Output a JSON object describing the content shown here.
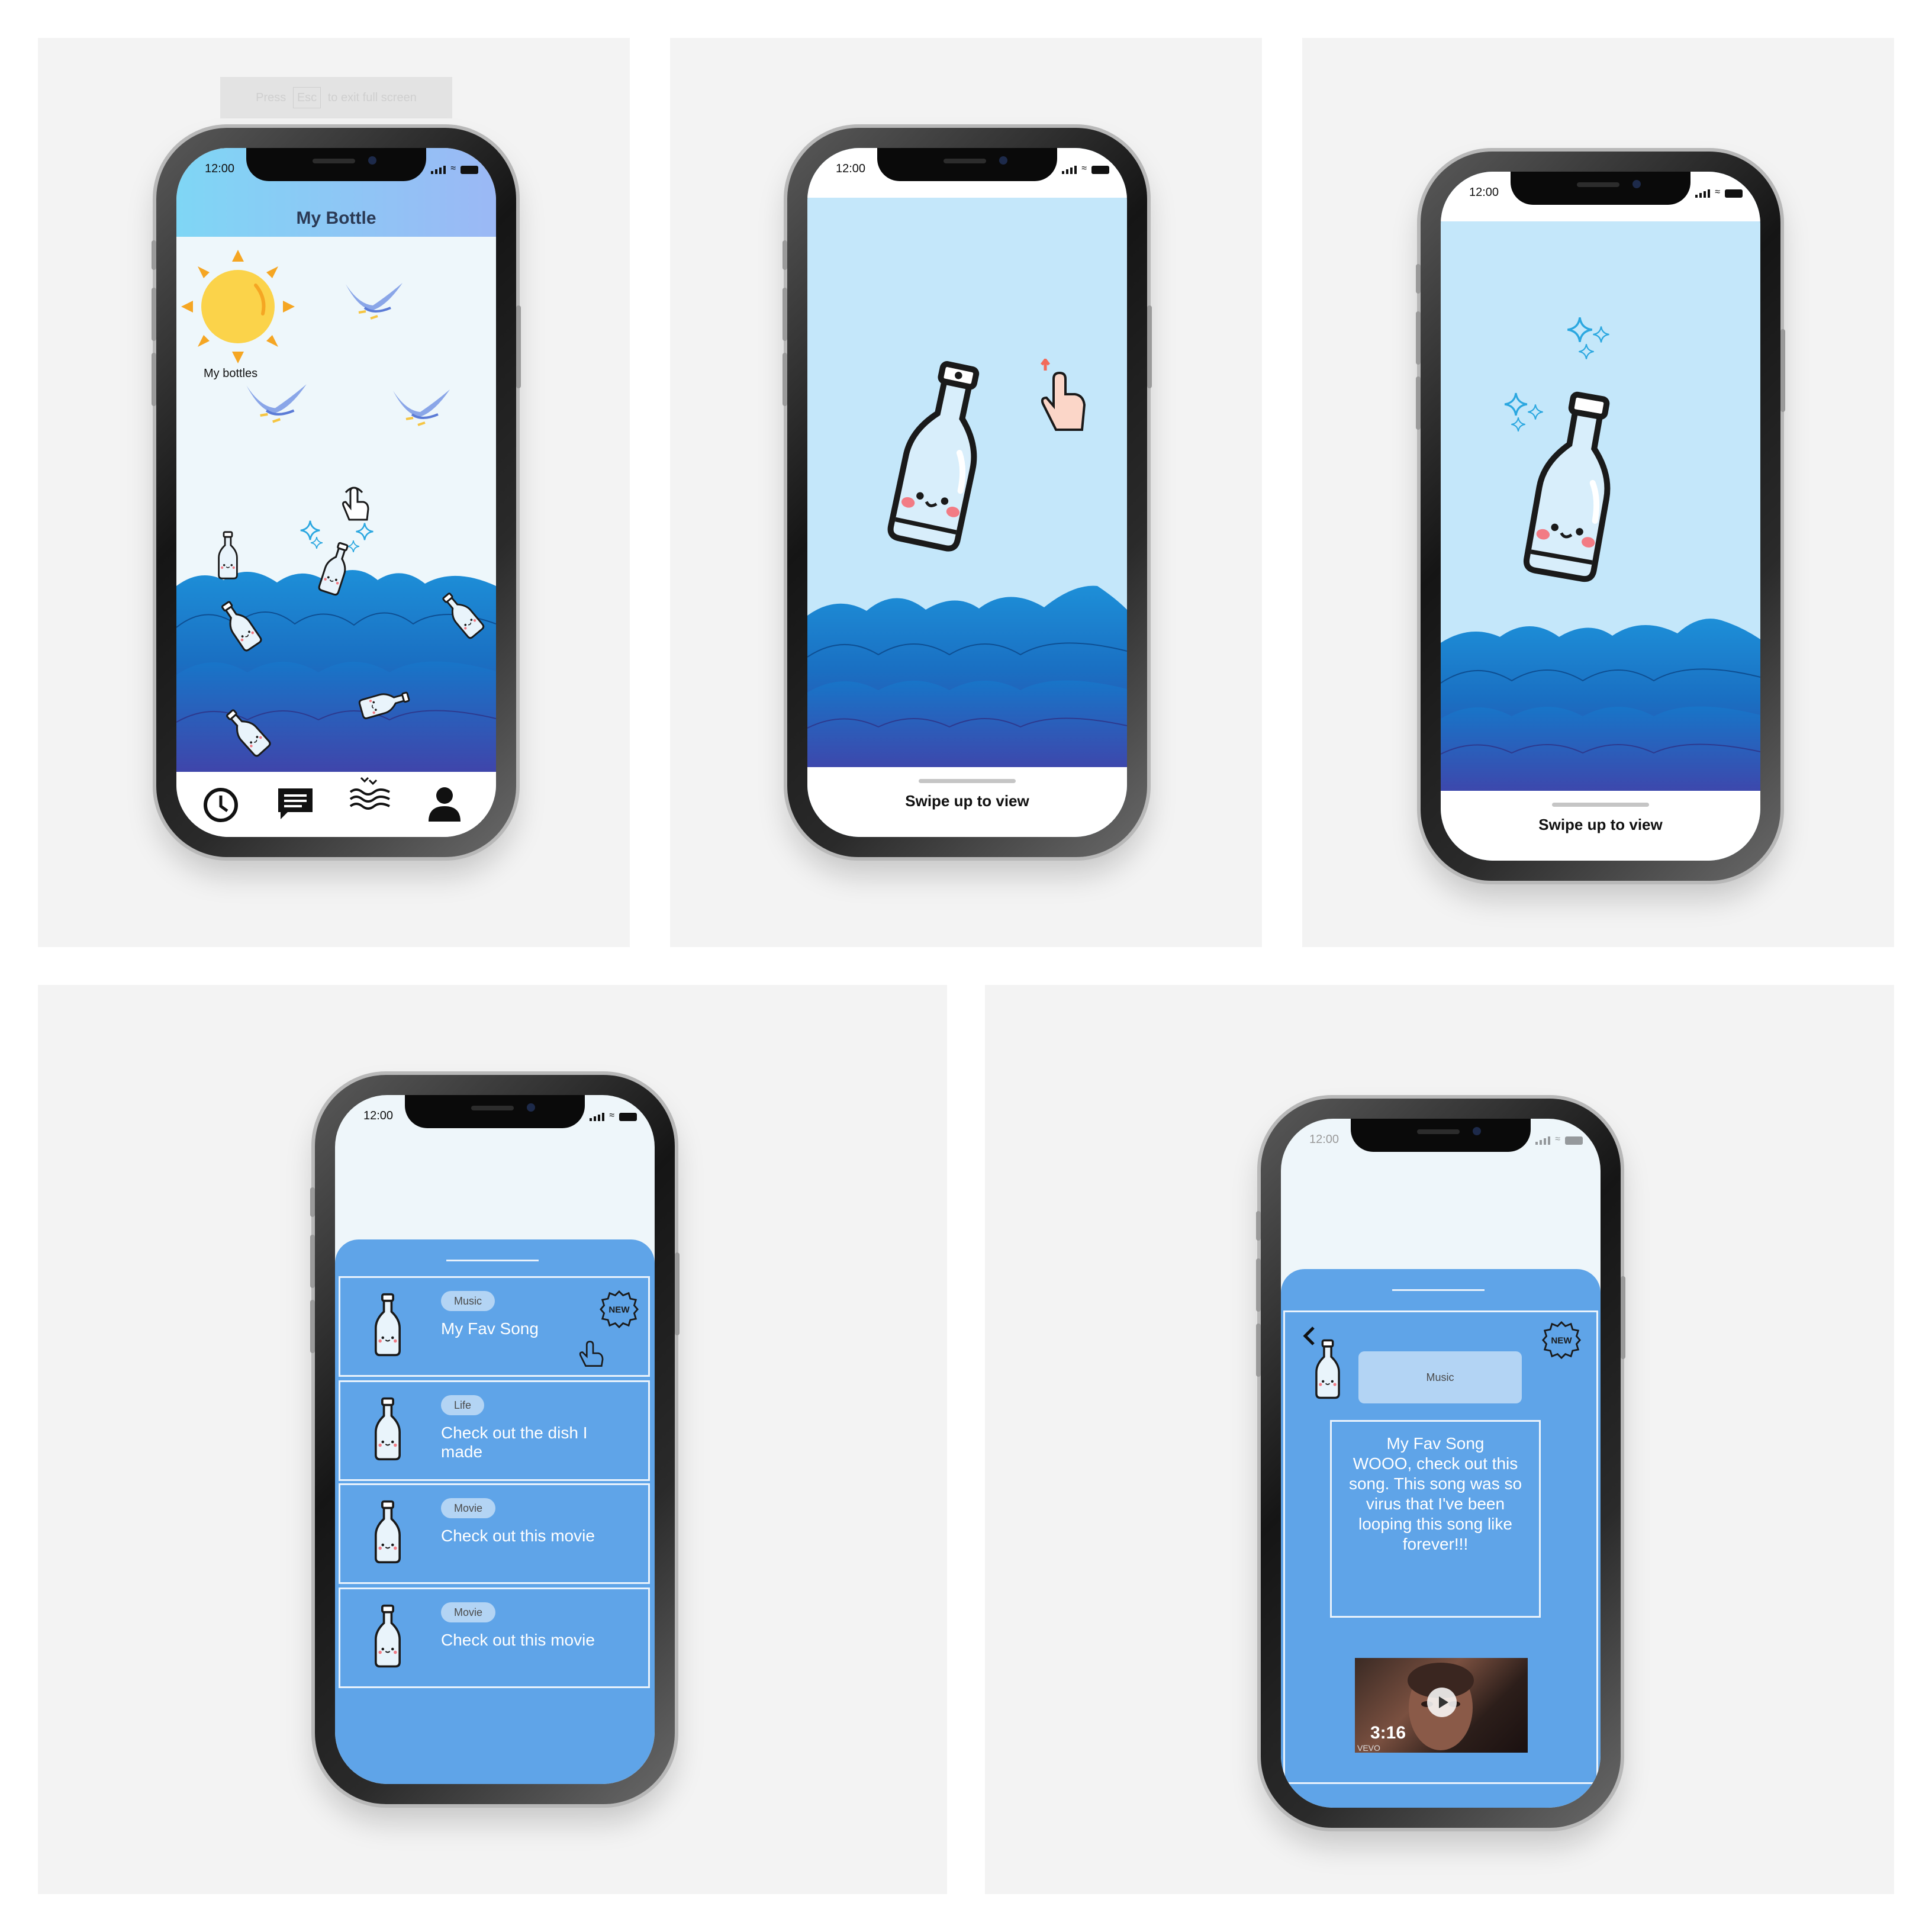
{
  "status_bar": {
    "time": "12:00"
  },
  "screen1": {
    "fullscreen_hint": {
      "prefix": "Press",
      "key": "Esc",
      "suffix": "to exit full screen"
    },
    "title": "My Bottle",
    "my_bottles_label": "My bottles",
    "tabs": [
      "history-icon",
      "chat-icon",
      "ocean-icon",
      "profile-icon"
    ]
  },
  "screen2": {
    "swipe_label": "Swipe up to view"
  },
  "screen3": {
    "swipe_label": "Swipe up to view"
  },
  "screen4": {
    "cards": [
      {
        "category": "Music",
        "title": "My Fav Song",
        "is_new": true
      },
      {
        "category": "Life",
        "title": "Check out the dish I made",
        "is_new": false
      },
      {
        "category": "Movie",
        "title": "Check out this movie",
        "is_new": false
      },
      {
        "category": "Movie",
        "title": "Check out this movie",
        "is_new": false
      }
    ],
    "new_badge": "NEW"
  },
  "screen5": {
    "category": "Music",
    "new_badge": "NEW",
    "message_title": "My Fav Song",
    "message_body": "WOOO, check out this song. This song was so virus that I've been looping this song like forever!!!",
    "video_duration": "3:16",
    "video_caption": "VEVO"
  },
  "colors": {
    "panel_bg": "#f3f3f3",
    "sky": "#c4e7fa",
    "header_gradient_start": "#7fd6f5",
    "header_gradient_end": "#9bb8f5",
    "sheet_blue": "#5fa4e8",
    "pill_blue": "#b3d4f4",
    "sun": "#fbd34a",
    "sun_rays": "#f5a623"
  }
}
